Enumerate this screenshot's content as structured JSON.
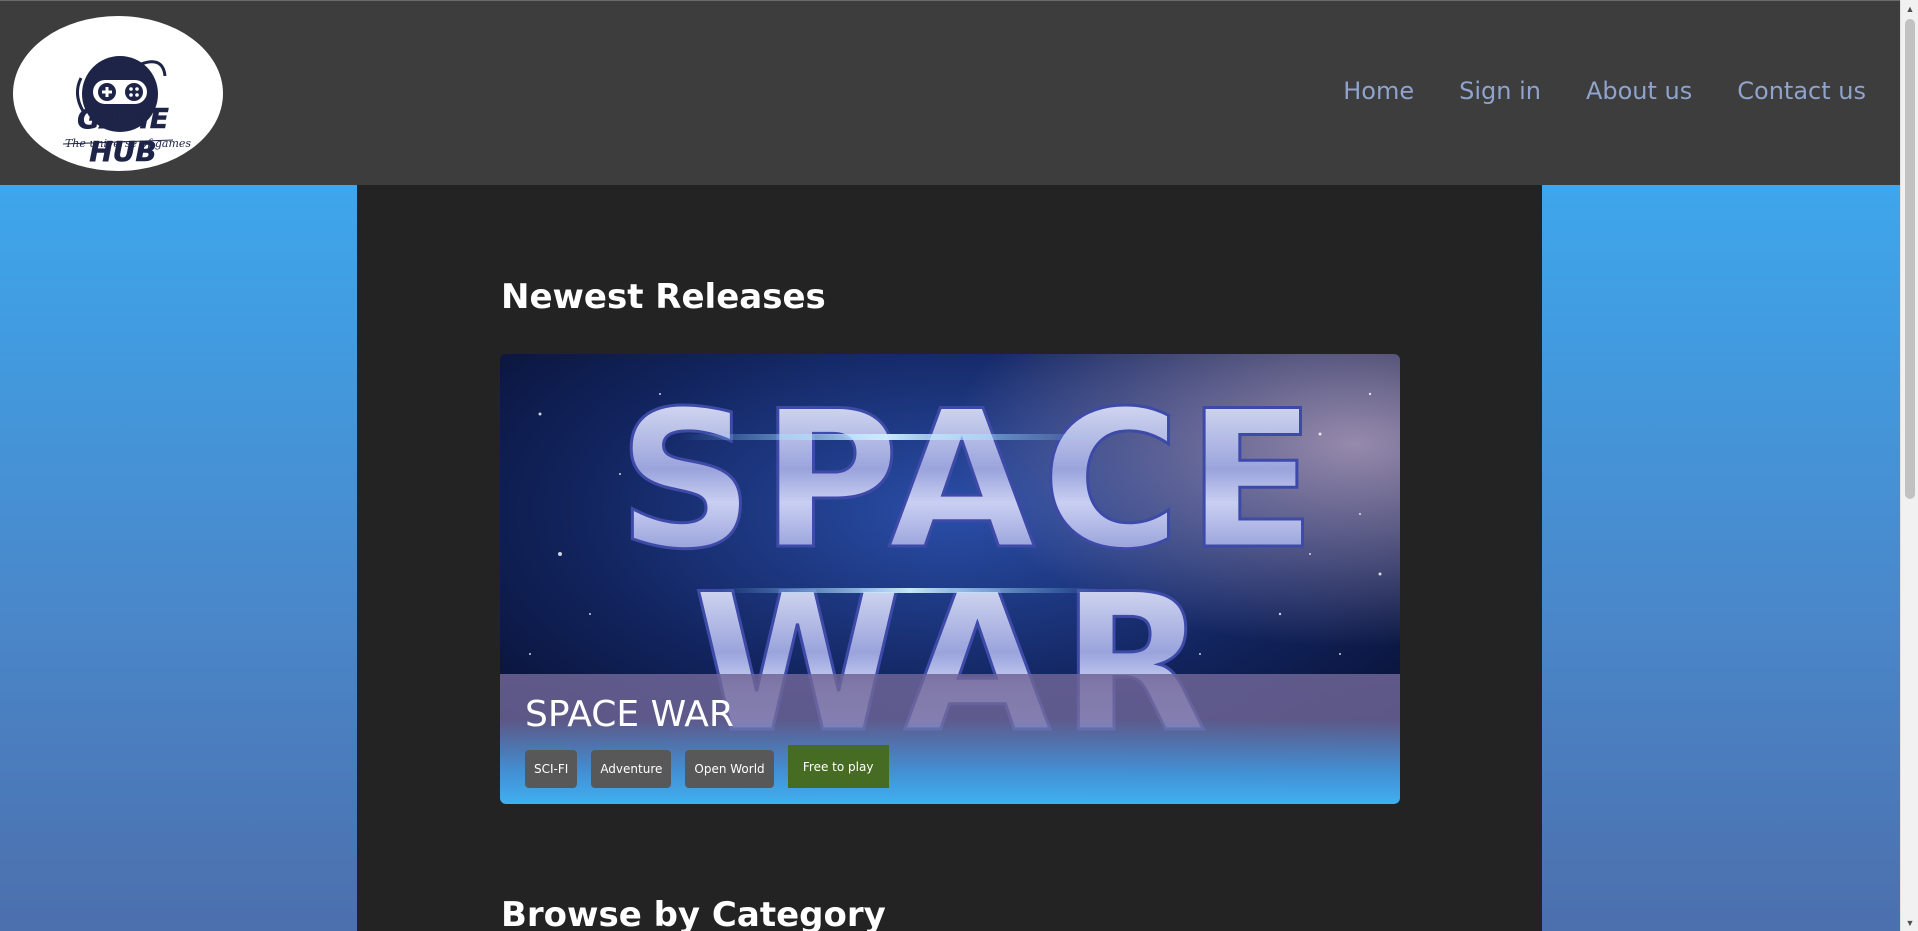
{
  "header": {
    "logo_title": "GAME HUB",
    "logo_tagline": "The universe of games",
    "nav": [
      "Home",
      "Sign in",
      "About us",
      "Contact us"
    ]
  },
  "main": {
    "newest_title": "Newest Releases",
    "featured": {
      "art_text_line1": "SPACE",
      "art_text_line2": "WAR",
      "title": "SPACE WAR",
      "tags": [
        "SCI-FI",
        "Adventure",
        "Open World"
      ],
      "cta": "Free to play"
    },
    "category_title": "Browse by Category"
  },
  "colors": {
    "header_bg": "#3d3d3d",
    "nav_link": "#8fa3cc",
    "main_bg": "#232323",
    "page_gradient_top": "#3ea6ec",
    "page_gradient_bottom": "#4c6fad",
    "tag_bg": "#585858",
    "cta_bg": "#466c24"
  }
}
